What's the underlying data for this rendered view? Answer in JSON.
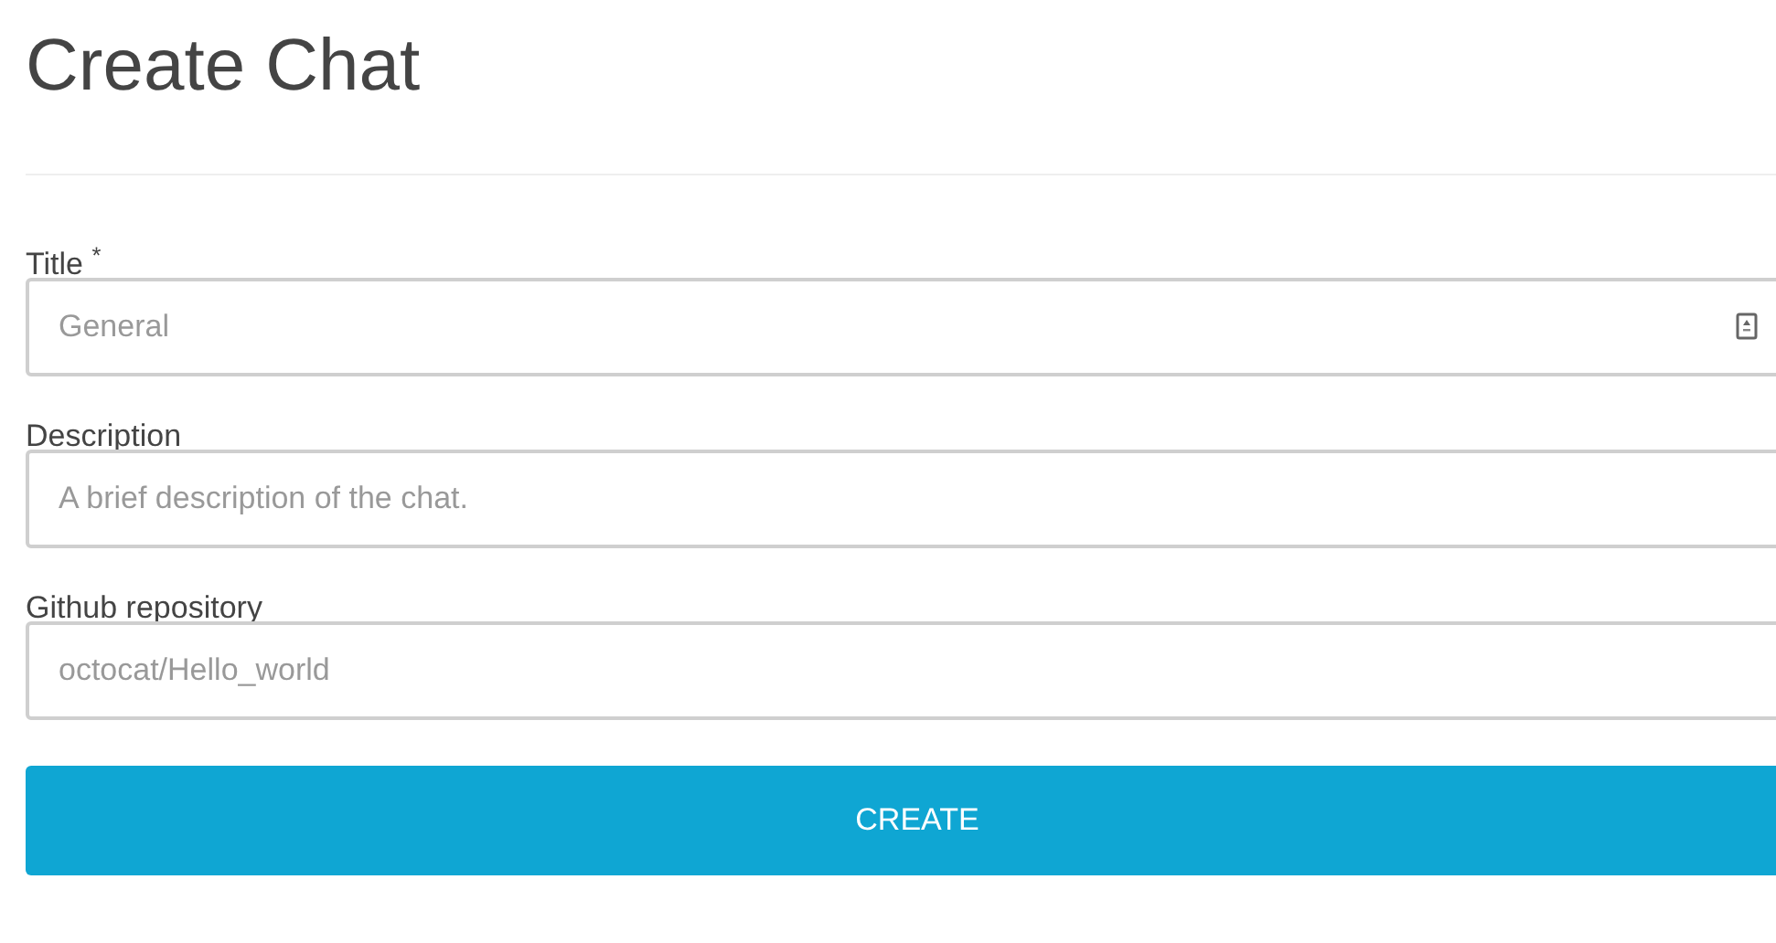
{
  "heading": "Create Chat",
  "fields": [
    {
      "label": "Title $^{*}$",
      "placeholder": "General",
      "has_icon": true
    },
    {
      "label": "Description",
      "placeholder": "A brief description of the chat."
    },
    {
      "label": "Github repository",
      "placeholder": "octocat/Hello_world"
    }
  ],
  "submit": "CREATE"
}
